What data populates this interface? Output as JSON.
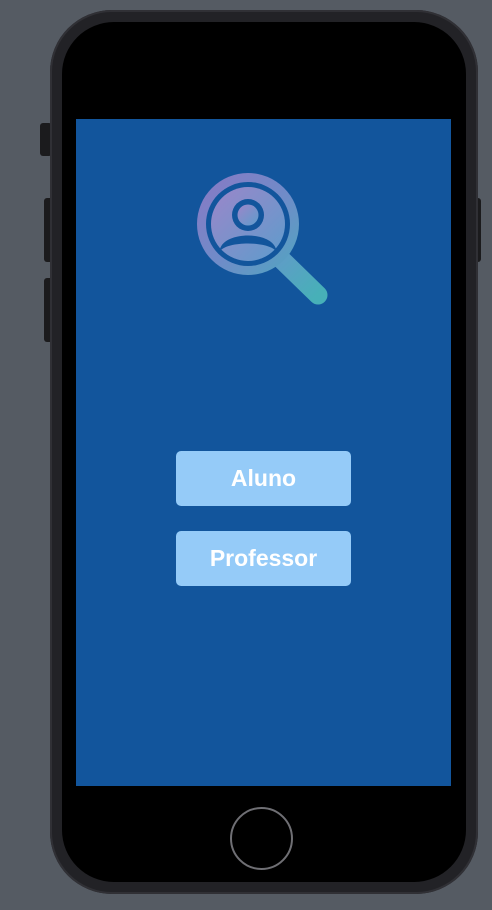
{
  "screen": {
    "background_color": "#12559c",
    "logo_icon": "person-search-icon",
    "buttons": [
      {
        "label": "Aluno",
        "color": "#95cbf8",
        "text_color": "#ffffff"
      },
      {
        "label": "Professor",
        "color": "#95cbf8",
        "text_color": "#ffffff"
      }
    ]
  },
  "device": {
    "model": "iphone-with-home-button",
    "frame_color": "#222226",
    "background_color": "#555b63"
  }
}
